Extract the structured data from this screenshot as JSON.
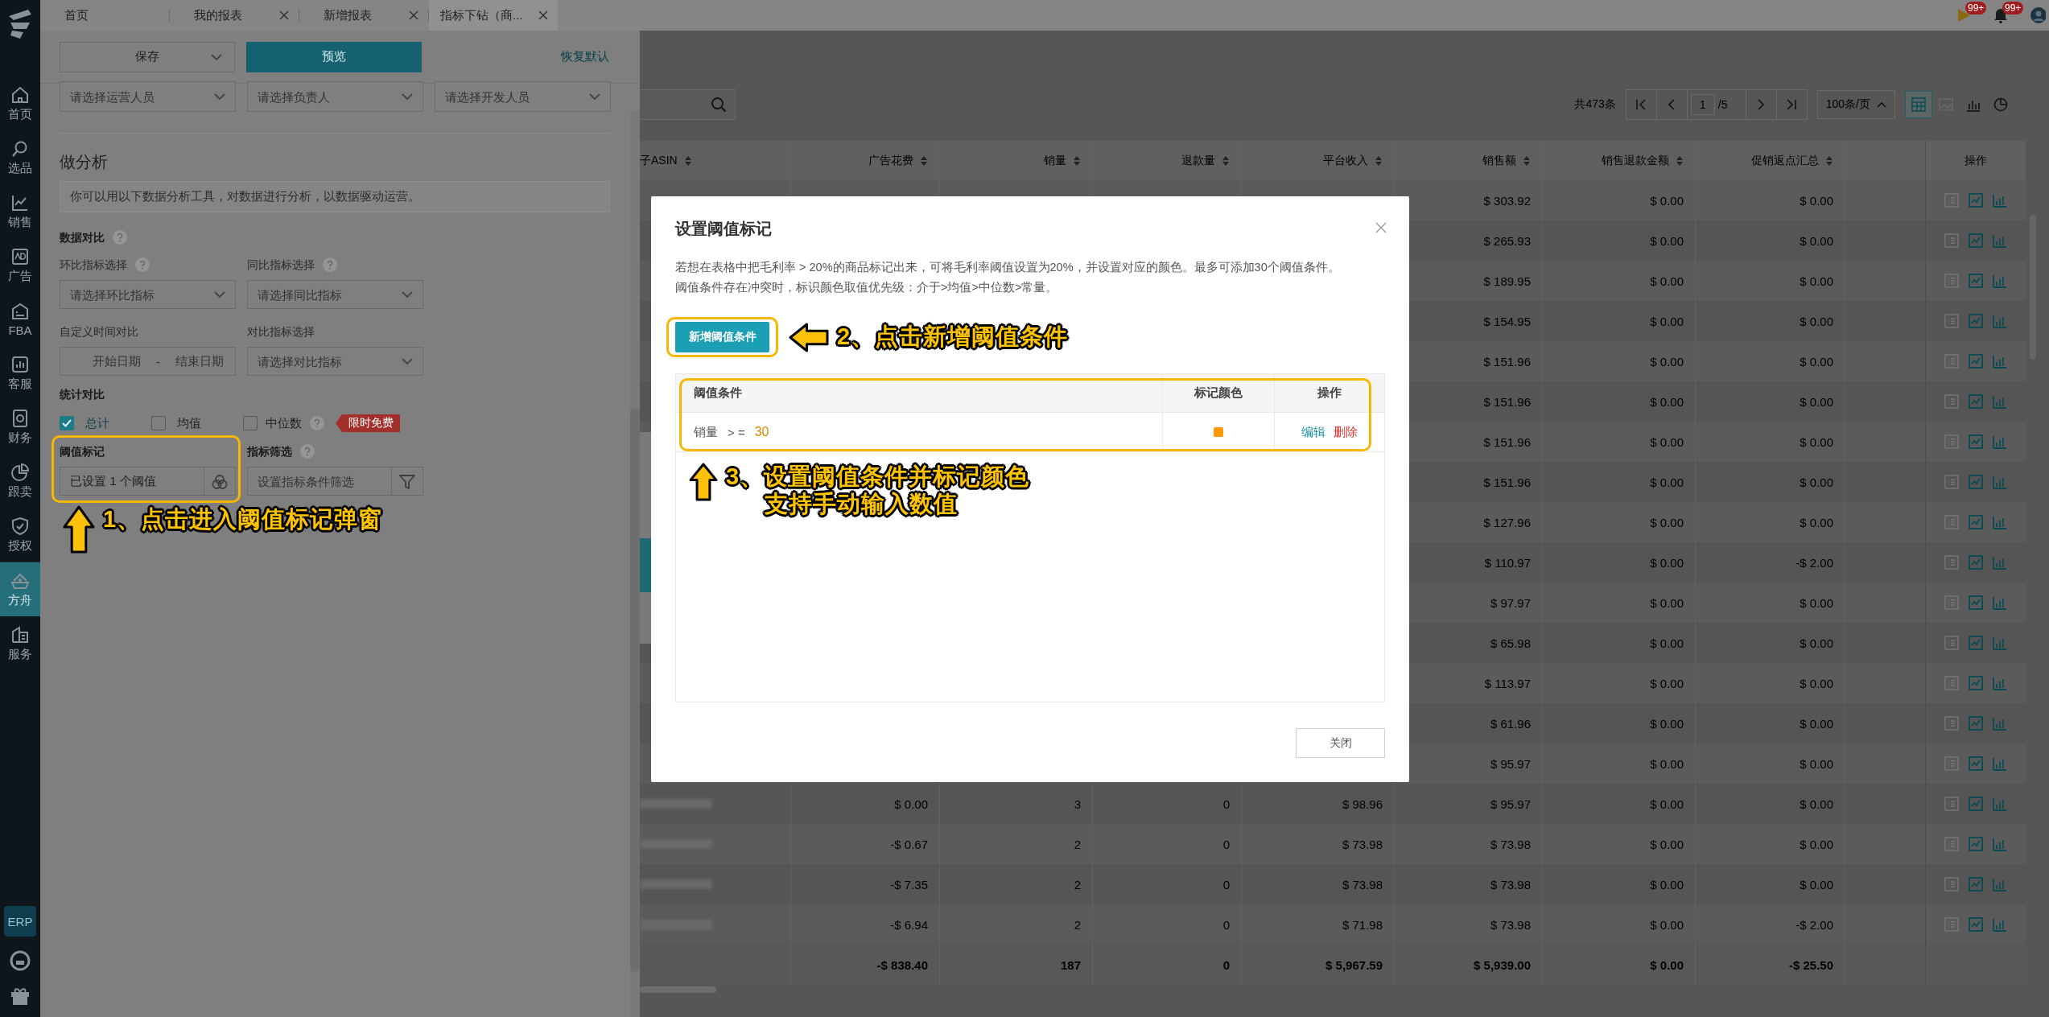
{
  "nav": {
    "items": [
      {
        "label": "首页",
        "selected": false
      },
      {
        "label": "选品",
        "selected": false
      },
      {
        "label": "销售",
        "selected": false
      },
      {
        "label": "广告",
        "selected": false
      },
      {
        "label": "FBA",
        "selected": false
      },
      {
        "label": "客服",
        "selected": false
      },
      {
        "label": "财务",
        "selected": false
      },
      {
        "label": "跟卖",
        "selected": false
      },
      {
        "label": "授权",
        "selected": false
      },
      {
        "label": "方舟",
        "selected": true
      },
      {
        "label": "服务",
        "selected": false
      }
    ],
    "badge": "ERP"
  },
  "tabs": [
    {
      "label": "首页",
      "selected": false,
      "closable": false
    },
    {
      "label": "我的报表",
      "selected": false,
      "closable": true
    },
    {
      "label": "新增报表",
      "selected": false,
      "closable": true
    },
    {
      "label": "指标下钻（商...",
      "selected": true,
      "closable": true
    }
  ],
  "top_bar": {
    "notifications": [
      {
        "count": "99+"
      },
      {
        "count": "99+"
      }
    ]
  },
  "panel": {
    "save": "保存",
    "preview": "预览",
    "reset": "恢复默认",
    "people": [
      {
        "placeholder": "请选择运营人员"
      },
      {
        "placeholder": "请选择负责人"
      },
      {
        "placeholder": "请选择开发人员"
      }
    ],
    "title": "做分析",
    "info": "你可以用以下数据分析工具，对数据进行分析，以数据驱动运营。",
    "data_compare": {
      "title": "数据对比",
      "help": true
    },
    "fields": [
      {
        "label": "环比指标选择",
        "help": true,
        "kind": "select",
        "placeholder": "请选择环比指标"
      },
      {
        "label": "同比指标选择",
        "help": true,
        "kind": "select",
        "placeholder": "请选择同比指标"
      },
      {
        "label": "自定义时间对比",
        "help": false,
        "kind": "daterange",
        "start": "开始日期",
        "separator": "-",
        "end": "结束日期"
      },
      {
        "label": "对比指标选择",
        "help": false,
        "kind": "select",
        "placeholder": "请选择对比指标"
      }
    ],
    "stat_compare": {
      "title": "统计对比",
      "options": [
        {
          "label": "总计",
          "checked": true,
          "help": false
        },
        {
          "label": "均值",
          "checked": false,
          "help": false
        },
        {
          "label": "中位数",
          "checked": false,
          "help": true,
          "tag": "限时免费"
        }
      ]
    },
    "tools": [
      {
        "label": "阈值标记",
        "help": false,
        "value": "已设置 1 个阈值",
        "highlighted": true
      },
      {
        "label": "指标筛选",
        "help": true,
        "placeholder": "设置指标条件筛选",
        "highlighted": false
      }
    ],
    "annotation": {
      "lines": [
        "1、点击进入阈值标记弹窗"
      ]
    }
  },
  "table": {
    "total": "共473条",
    "pager": {
      "page": "1",
      "pages": "/5"
    },
    "page_size": "100条/页",
    "views": [
      {
        "selected": true
      },
      {
        "selected": false
      },
      {
        "selected": false
      },
      {
        "selected": false
      }
    ],
    "columns": [
      "子ASIN",
      "广告花费",
      "销量",
      "退款量",
      "平台收入",
      "销售额",
      "销售退款金额",
      "促销返点汇总"
    ],
    "action_column": "操作",
    "rows": [
      {
        "asin_blurred": false,
        "cells": [
          "",
          "",
          "",
          "",
          "",
          "$ 303.92",
          "$ 0.00",
          "$ 0.00"
        ]
      },
      {
        "asin_blurred": false,
        "cells": [
          "",
          "",
          "",
          "",
          "",
          "$ 265.93",
          "$ 0.00",
          "$ 0.00"
        ]
      },
      {
        "asin_blurred": false,
        "cells": [
          "",
          "",
          "",
          "",
          "",
          "$ 189.95",
          "$ 0.00",
          "$ 0.00"
        ]
      },
      {
        "asin_blurred": false,
        "cells": [
          "",
          "",
          "",
          "",
          "",
          "$ 154.95",
          "$ 0.00",
          "$ 0.00"
        ]
      },
      {
        "asin_blurred": false,
        "cells": [
          "",
          "",
          "",
          "",
          "",
          "$ 151.96",
          "$ 0.00",
          "$ 0.00"
        ]
      },
      {
        "asin_blurred": false,
        "cells": [
          "",
          "",
          "",
          "",
          "",
          "$ 151.96",
          "$ 0.00",
          "$ 0.00"
        ]
      },
      {
        "asin_blurred": false,
        "cells": [
          "",
          "",
          "",
          "",
          "",
          "$ 151.96",
          "$ 0.00",
          "$ 0.00"
        ]
      },
      {
        "asin_blurred": false,
        "cells": [
          "",
          "",
          "",
          "",
          "",
          "$ 151.96",
          "$ 0.00",
          "$ 0.00"
        ]
      },
      {
        "asin_blurred": false,
        "cells": [
          "",
          "",
          "",
          "",
          "",
          "$ 127.96",
          "$ 0.00",
          "$ 0.00"
        ]
      },
      {
        "asin_blurred": false,
        "cells": [
          "",
          "",
          "",
          "",
          "",
          "$ 110.97",
          "$ 0.00",
          "-$ 2.00"
        ]
      },
      {
        "asin_blurred": false,
        "cells": [
          "",
          "",
          "",
          "",
          "",
          "$ 97.97",
          "$ 0.00",
          "$ 0.00"
        ]
      },
      {
        "asin_blurred": false,
        "cells": [
          "",
          "",
          "",
          "",
          "",
          "$ 65.98",
          "$ 0.00",
          "$ 0.00"
        ]
      },
      {
        "asin_blurred": false,
        "cells": [
          "",
          "",
          "",
          "",
          "",
          "$ 113.97",
          "$ 0.00",
          "$ 0.00"
        ]
      },
      {
        "asin_blurred": false,
        "cells": [
          "",
          "",
          "",
          "",
          "",
          "$ 61.96",
          "$ 0.00",
          "$ 0.00"
        ]
      },
      {
        "asin_blurred": false,
        "cells": [
          "",
          "",
          "",
          "",
          "",
          "$ 95.97",
          "$ 0.00",
          "$ 0.00"
        ]
      },
      {
        "asin_blurred": true,
        "cells": [
          "",
          "$ 0.00",
          "3",
          "0",
          "$ 98.96",
          "$ 95.97",
          "$ 0.00",
          "$ 0.00"
        ]
      },
      {
        "asin_blurred": true,
        "cells": [
          "",
          "-$ 0.67",
          "2",
          "0",
          "$ 73.98",
          "$ 73.98",
          "$ 0.00",
          "$ 0.00"
        ]
      },
      {
        "asin_blurred": true,
        "cells": [
          "",
          "-$ 7.35",
          "2",
          "0",
          "$ 73.98",
          "$ 73.98",
          "$ 0.00",
          "$ 0.00"
        ]
      },
      {
        "asin_blurred": true,
        "cells": [
          "",
          "-$ 6.94",
          "2",
          "0",
          "$ 71.98",
          "$ 73.98",
          "$ 0.00",
          "-$ 2.00"
        ]
      }
    ],
    "totals": {
      "cells": [
        "",
        "-$ 838.40",
        "187",
        "0",
        "$ 5,967.59",
        "$ 5,939.00",
        "$ 0.00",
        "-$ 25.50"
      ]
    }
  },
  "modal": {
    "title": "设置阈值标记",
    "description": [
      "若想在表格中把毛利率 > 20%的商品标记出来，可将毛利率阈值设置为20%，并设置对应的颜色。最多可添加30个阈值条件。",
      "阈值条件存在冲突时，标识颜色取值优先级：介于>均值>中位数>常量。"
    ],
    "add_button": "新增阈值条件",
    "add_highlighted": true,
    "annotation_add": {
      "lines": [
        "2、点击新增阈值条件"
      ]
    },
    "columns": [
      "阈值条件",
      "标记颜色",
      "操作"
    ],
    "rules": [
      {
        "metric": "销量",
        "operator": "> =",
        "value": "30",
        "color": "#ff9800",
        "actions": [
          {
            "label": "编辑",
            "kind": "edit"
          },
          {
            "label": "删除",
            "kind": "delete"
          }
        ]
      }
    ],
    "table_highlighted": true,
    "annotation_table": {
      "lines": [
        "3、设置阈值条件并标记颜色",
        "支持手动输入数值"
      ]
    },
    "close": "关闭"
  }
}
